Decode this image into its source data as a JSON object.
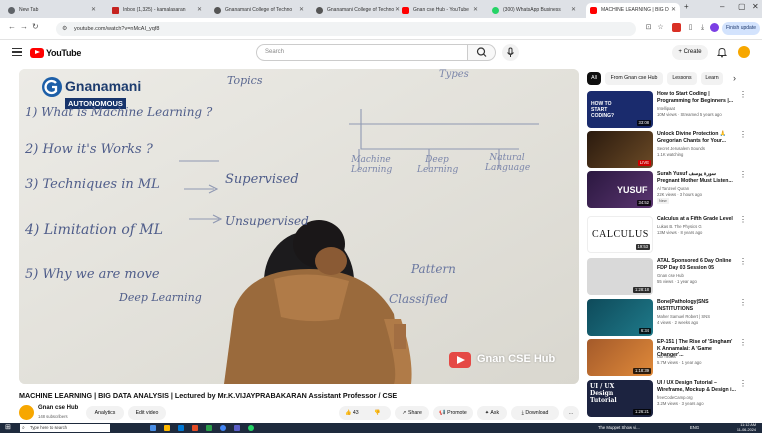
{
  "browser": {
    "tabs": [
      {
        "label": "New Tab",
        "color": "#5f6368"
      },
      {
        "label": "Inbox (1,325) - kamalasaran",
        "color": "#c5221f"
      },
      {
        "label": "Gnanamani College of Techno",
        "color": "#555555"
      },
      {
        "label": "Gnanamani College of Techno",
        "color": "#555555"
      },
      {
        "label": "Gnan cse Hub - YouTube",
        "color": "#ff0000"
      },
      {
        "label": "(300) WhatsApp Business",
        "color": "#25d366"
      },
      {
        "label": "MACHINE LEARNING | BIG D",
        "color": "#ff0000"
      }
    ],
    "url": "youtube.com/watch?v=nMcAI_yqf8",
    "finish_update": "Finish update"
  },
  "youtube": {
    "logo": "YouTube",
    "search_placeholder": "Search",
    "create_label": "Create"
  },
  "video": {
    "title": "MACHINE LEARNING | BIG DATA ANALYSIS | Lectured by Mr.K.VIJAYPRABAKARAN Assistant Professor / CSE",
    "watermark": "Gnan CSE Hub",
    "college_logo": "Gnanamani",
    "autonomous": "AUTONOMOUS",
    "board": {
      "heading_topics": "Topics",
      "heading_types": "Types",
      "line1": "1) What is Machine Learning ?",
      "line2": "2) How it's Works ?",
      "line3": "3) Techniques in ML",
      "line4": "4) Limitation of ML",
      "line5": "5) Why we are move",
      "line5b": "Deep Learning",
      "supervised": "Supervised",
      "unsupervised": "Unsupervised",
      "machine_learning": "Machine Learning",
      "deep_learning": "Deep Learning",
      "natural_language": "Natural Language",
      "pattern": "Pattern",
      "classified": "Classified"
    }
  },
  "channel": {
    "name": "Gnan cse Hub",
    "subscribers": "148 subscribers",
    "analytics": "Analytics",
    "edit_video": "Edit video",
    "likes": "43",
    "share": "Share",
    "promote": "Promote",
    "ask": "Ask",
    "download": "Download",
    "more": "..."
  },
  "chips": [
    "All",
    "From Gnan cse Hub",
    "Lessons",
    "Learn"
  ],
  "recommendations": [
    {
      "title": "How to Start Coding | Programming for Beginners |...",
      "channel": "Intellipaat",
      "meta": "10M views · Streamed 5 years ago",
      "duration": "33:08",
      "bg": "#1a2b6d"
    },
    {
      "title": "Unlock Divine Protection 🙏 Gregorian Chants for Your...",
      "channel": "Secret Jerusalem Sounds",
      "meta": "1.1K watching",
      "duration": "LIVE",
      "bg": "#3b2a1a"
    },
    {
      "title": "Surah Yusuf سورة يوسف Pregnant Mother Must Listen...",
      "channel": "Al Tanzeel Quran",
      "meta": "22K views · 3 hours ago",
      "duration": "34:52",
      "bg": "#3a2450",
      "new": "New"
    },
    {
      "title": "Calculus at a Fifth Grade Level",
      "channel": "Lukas B. The Physics G",
      "meta": "13M views · 8 years ago",
      "duration": "19:53",
      "bg": "#ffffff"
    },
    {
      "title": "ATAL Sponsored 6 Day Online FDP Day 03 Session 05",
      "channel": "Gnan cse Hub",
      "meta": "55 views · 1 year ago",
      "duration": "1:28:18",
      "bg": "#d9d9d9"
    },
    {
      "title": "Bone|Pathology|SNS INSTITUTIONS",
      "channel": "Maher Samuel Robert | SNS",
      "meta": "4 views · 2 weeks ago",
      "duration": "6:34",
      "bg": "#0e4a5a"
    },
    {
      "title": "EP-151 | The Rise of 'Singham' K Annamalai: A 'Game Changer'...",
      "channel": "Ubi heads",
      "meta": "5.7M views · 1 year ago",
      "duration": "1:18:39",
      "bg": "#a45a2a"
    },
    {
      "title": "UI / UX Design Tutorial – Wireframe, Mockup & Design i...",
      "channel": "freeCodeCamp.org",
      "meta": "3.2M views · 3 years ago",
      "duration": "1:26:21",
      "bg": "#1c2340"
    }
  ],
  "calc_label": "CALCULUS",
  "yusuf_label": "YUSUF",
  "uiux_label": "UI / UX Design Tutorial",
  "coding_label": "HOW TO START CODING?",
  "taskbar": {
    "search": "Type here to search",
    "now_playing": "The Muppet Show vi...",
    "lang": "ENG",
    "time": "11:12 AM",
    "date": "11-06-2024"
  }
}
